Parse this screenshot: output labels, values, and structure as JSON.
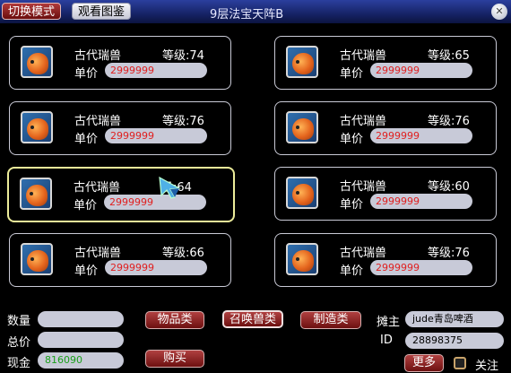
{
  "window": {
    "title": "9层法宝天阵B",
    "mode_button": "切换模式",
    "catalog_button": "观看图鉴",
    "close_icon": "close-icon"
  },
  "listings": [
    {
      "name": "古代瑞兽",
      "level": "等级:74",
      "price_label": "单价",
      "price": "2999999"
    },
    {
      "name": "古代瑞兽",
      "level": "等级:65",
      "price_label": "单价",
      "price": "2999999"
    },
    {
      "name": "古代瑞兽",
      "level": "等级:76",
      "price_label": "单价",
      "price": "2999999"
    },
    {
      "name": "古代瑞兽",
      "level": "等级:76",
      "price_label": "单价",
      "price": "2999999"
    },
    {
      "name": "古代瑞兽",
      "level": "级:64",
      "price_label": "单价",
      "price": "2999999",
      "selected": true
    },
    {
      "name": "古代瑞兽",
      "level": "等级:60",
      "price_label": "单价",
      "price": "2999999"
    },
    {
      "name": "古代瑞兽",
      "level": "等级:66",
      "price_label": "单价",
      "price": "2999999"
    },
    {
      "name": "古代瑞兽",
      "level": "等级:76",
      "price_label": "单价",
      "price": "2999999"
    }
  ],
  "footer": {
    "quantity_label": "数量",
    "quantity_value": "",
    "total_label": "总价",
    "total_value": "",
    "cash_label": "现金",
    "cash_value": "816090",
    "buy_button": "购买",
    "categories": [
      "物品类",
      "召唤兽类",
      "制造类"
    ],
    "active_category": "召唤兽类",
    "owner_label": "摊主",
    "owner_value": "jude青岛啤酒",
    "id_label": "ID",
    "id_value": "28898375",
    "more_button": "更多",
    "follow_label": "关注"
  },
  "colors": {
    "title_bar": "#162366",
    "price_text": "#e02020",
    "cash_text": "#1aa01a",
    "selected_border": "#ecec9a",
    "button_red": "#8c2020"
  }
}
